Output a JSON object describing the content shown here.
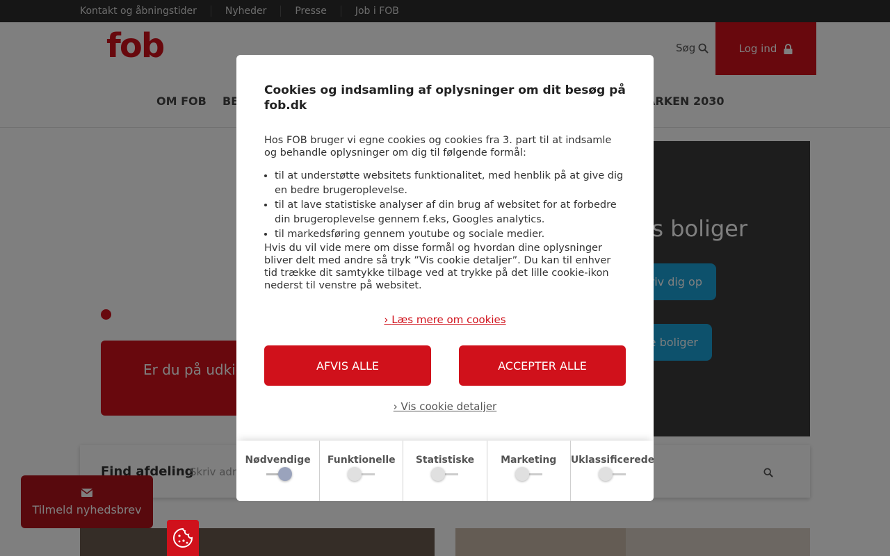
{
  "topbar": {
    "links": [
      "Kontakt og åbningstider",
      "Nyheder",
      "Presse",
      "Job i FOB"
    ]
  },
  "header": {
    "logo": "fob",
    "search_label": "Søg",
    "login_label": "Log ind",
    "nav": {
      "item_1": "OM FOB",
      "item_2": "BE",
      "item_3": "ARKEN 2030"
    }
  },
  "hero": {
    "title": "es boliger",
    "button_1": "riv dig op",
    "button_2": "e boliger",
    "udkig_text": "Er du på udkig"
  },
  "find": {
    "label": "Find afdeling",
    "placeholder": "Skriv adre"
  },
  "newsletter": {
    "label": "Tilmeld nyhedsbrev"
  },
  "cookie_modal": {
    "title": "Cookies og indsamling af oplysninger om dit besøg på fob.dk",
    "intro": "Hos FOB bruger vi egne cookies og cookies fra 3. part til at indsamle og behandle oplysninger om dig til følgende formål:",
    "purposes": [
      "til at understøtte websitets funktionalitet, med henblik på at give dig en bedre brugeroplevelse.",
      "til at lave statistiske analyser af din brug af websitet for at forbedre din brugeroplevelse gennem f.eks, Googles analytics.",
      "til markedsføring gennem youtube og sociale medier."
    ],
    "more_info": "Hvis du vil vide mere om disse formål og hvordan dine oplysninger bliver delt med andre så tryk ”Vis cookie detaljer”. Du kan til enhver tid trække dit samtykke tilbage ved at trykke på det lille cookie-ikon nederst til venstre på websitet.",
    "read_more_label": "Læs mere om cookies",
    "deny_label": "AFVIS ALLE",
    "accept_label": "ACCEPTER ALLE",
    "details_label": "Vis cookie detaljer",
    "categories": [
      {
        "label": "Nødvendige",
        "enabled": true
      },
      {
        "label": "Funktionelle",
        "enabled": false
      },
      {
        "label": "Statistiske",
        "enabled": false
      },
      {
        "label": "Marketing",
        "enabled": false
      },
      {
        "label": "Uklassificerede",
        "enabled": false
      }
    ]
  },
  "colors": {
    "brand_red": "#d0111b",
    "topbar": "#2d2d2d",
    "hero_blue": "#1aa3d8"
  }
}
